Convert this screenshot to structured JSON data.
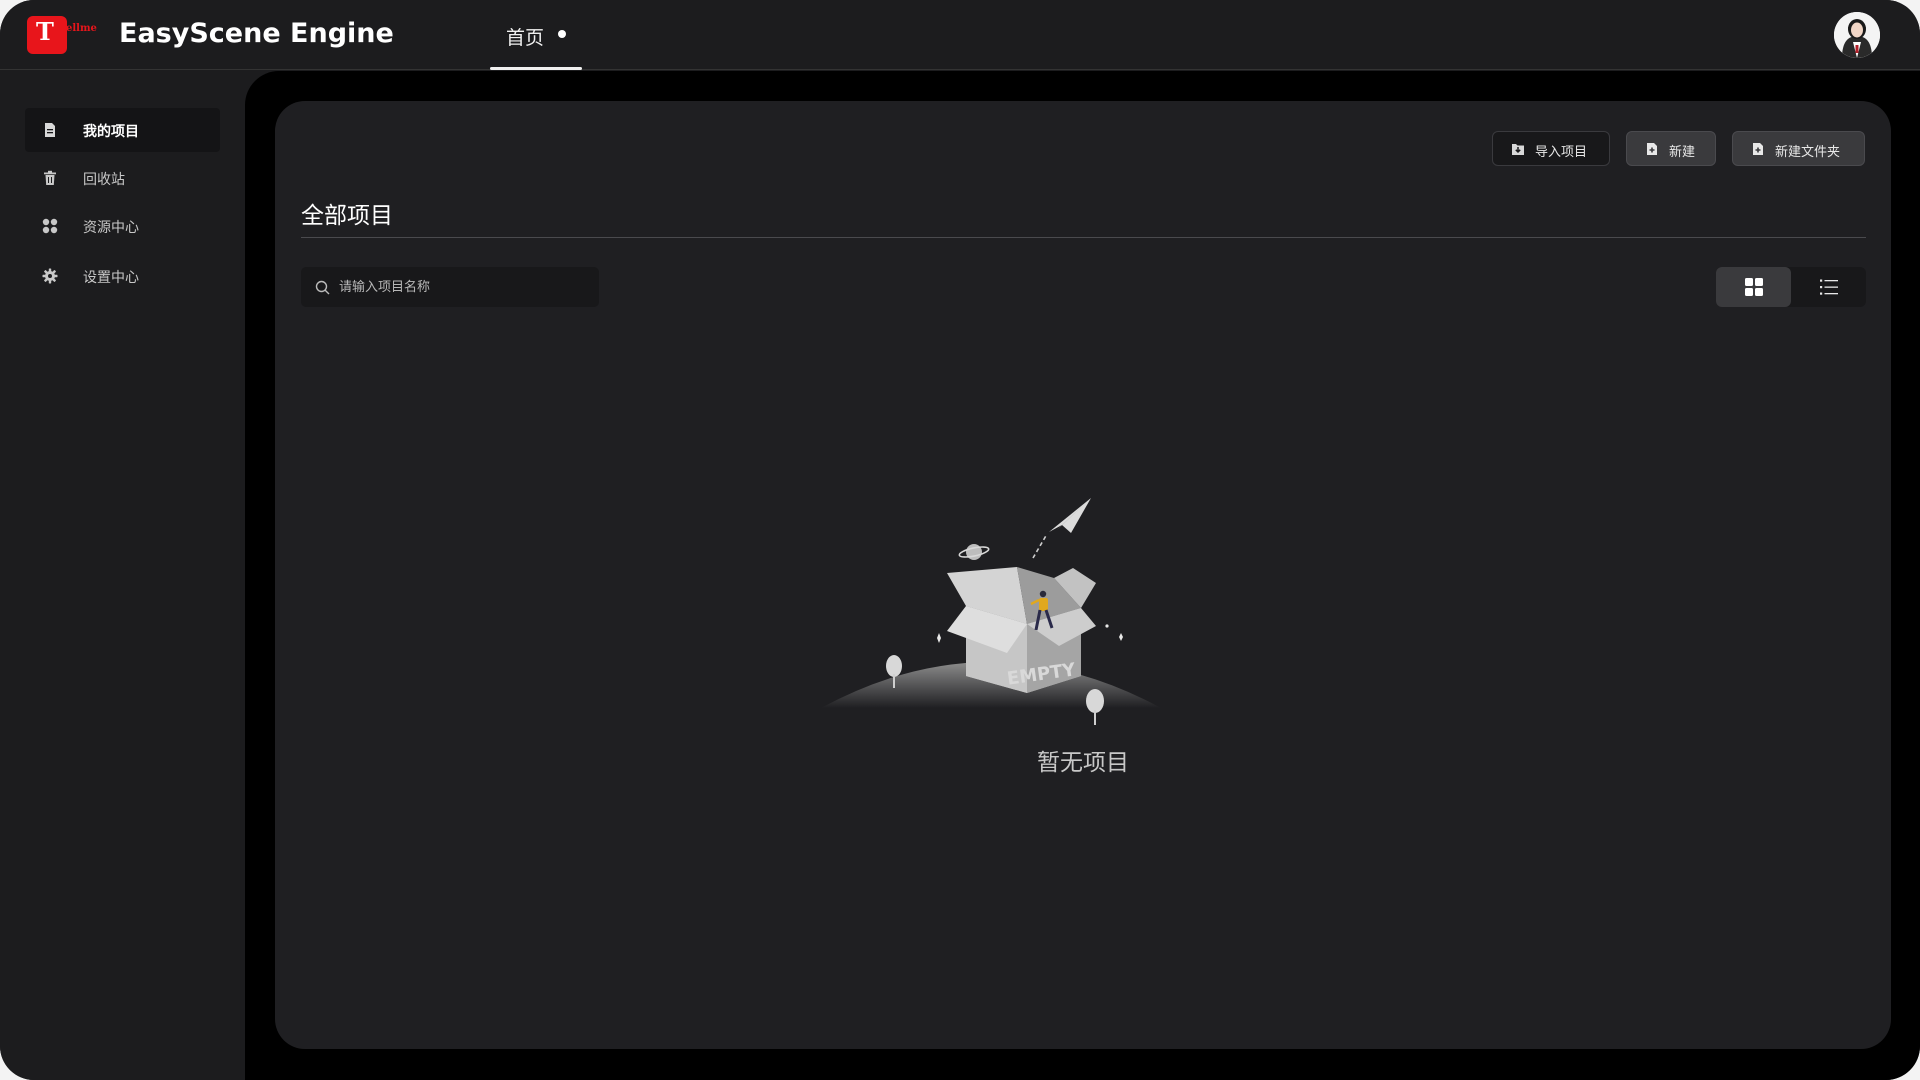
{
  "header": {
    "logo_letter": "T",
    "logo_text": "ellme",
    "app_title": "EasyScene Engine",
    "nav_tab_label": "首页"
  },
  "sidebar": {
    "items": [
      {
        "label": "我的项目",
        "icon": "document-icon",
        "active": true
      },
      {
        "label": "回收站",
        "icon": "trash-icon",
        "active": false
      },
      {
        "label": "资源中心",
        "icon": "apps-icon",
        "active": false
      },
      {
        "label": "设置中心",
        "icon": "gear-icon",
        "active": false
      }
    ]
  },
  "toolbar": {
    "import_label": "导入项目",
    "new_label": "新建",
    "new_folder_label": "新建文件夹"
  },
  "main": {
    "section_title": "全部项目",
    "search_placeholder": "请输入项目名称",
    "empty_box_text": "EMPTY",
    "empty_text": "暂无项目"
  },
  "colors": {
    "brand_red": "#e8151b",
    "background": "#1c1c1e",
    "panel": "#1f1f22"
  }
}
